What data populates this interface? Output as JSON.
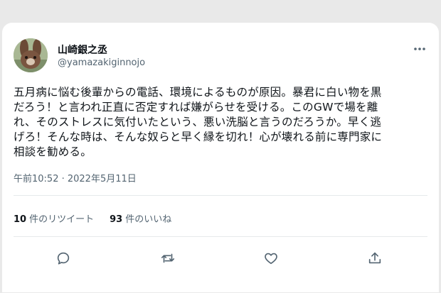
{
  "user": {
    "display_name": "山崎銀之丞",
    "handle": "@yamazakiginnojo",
    "avatar_icon": "rabbit-avatar"
  },
  "tweet": {
    "text_lines": [
      "五月病に悩む後輩からの電話、環境によるものが原因。暴君に白い物を黒",
      "だろう！と言われ正直に否定すれば嫌がらせを受ける。このGWで場を離",
      "れ、そのストレスに気付いたという、悪い洗脳と言うのだろうか。早く逃",
      "げろ！そんな時は、そんな奴らと早く縁を切れ！心が壊れる前に専門家に",
      "相談を勧める。"
    ],
    "timestamp": "午前10:52 · 2022年5月11日"
  },
  "stats": {
    "retweets_count": "10",
    "retweets_label": "件のリツイート",
    "likes_count": "93",
    "likes_label": "件のいいね"
  },
  "actions": {
    "reply_icon": "reply-icon",
    "retweet_icon": "retweet-icon",
    "like_icon": "heart-icon",
    "share_icon": "share-icon",
    "more_icon": "more-icon"
  },
  "colors": {
    "text_primary": "#0f1419",
    "text_secondary": "#536471",
    "background": "#ffffff",
    "frame": "#e9e9e9"
  }
}
